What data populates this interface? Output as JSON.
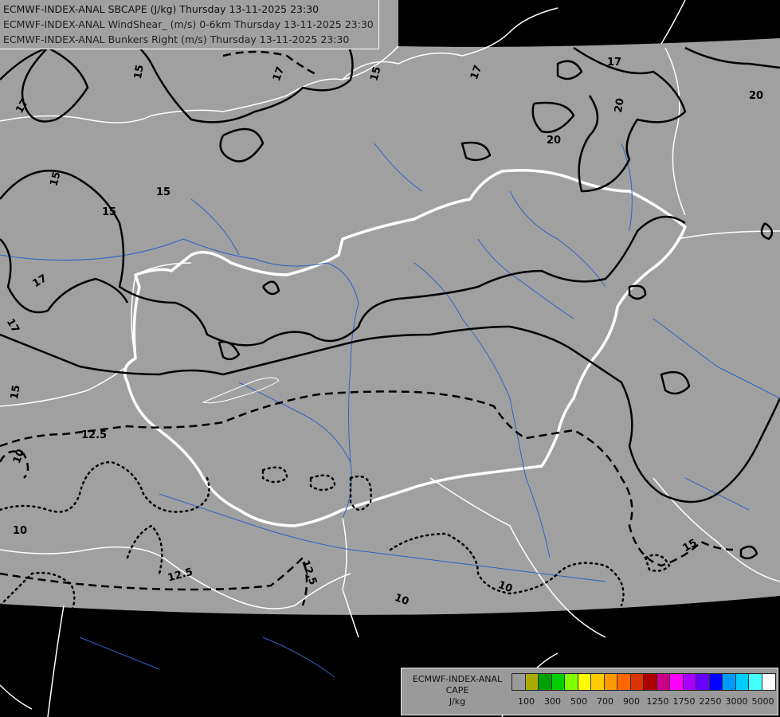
{
  "titles": [
    "ECMWF-INDEX-ANAL SBCAPE (J/kg) Thursday 13-11-2025 23:30",
    "ECMWF-INDEX-ANAL WindShear_ (m/s) 0-6km Thursday 13-11-2025 23:30",
    "ECMWF-INDEX-ANAL Bunkers Right (m/s) Thursday 13-11-2025 23:30"
  ],
  "colors": {
    "outside": "#000000",
    "domain_fill": "#a0a0a0",
    "borders": "#ffffff",
    "rivers": "#2f62c4",
    "contours": "#000000"
  },
  "contour_labels": {
    "solid": [
      "15",
      "17",
      "15",
      "17",
      "17",
      "20",
      "20",
      "20",
      "15",
      "15",
      "15",
      "17",
      "17",
      "15",
      "17",
      "15"
    ],
    "dashed": [
      "12.5",
      "12.5",
      "12.5"
    ],
    "dotted": [
      "10",
      "10",
      "10",
      "10"
    ]
  },
  "legend": {
    "title_lines": [
      "ECMWF-INDEX-ANAL",
      "CAPE",
      "J/kg"
    ],
    "swatch_colors": [
      "#9a9a9a",
      "#aaaa00",
      "#00a000",
      "#00d000",
      "#80ff00",
      "#ffff00",
      "#ffcc00",
      "#ff9900",
      "#ff6600",
      "#dd3300",
      "#aa0000",
      "#cc0088",
      "#ff00ff",
      "#aa00ff",
      "#6600ff",
      "#0000ff",
      "#0099ff",
      "#00ccff",
      "#44ffff",
      "#ffffff"
    ],
    "tick_labels": [
      "100",
      "300",
      "500",
      "700",
      "900",
      "1250",
      "1750",
      "2250",
      "3000",
      "5000"
    ]
  }
}
